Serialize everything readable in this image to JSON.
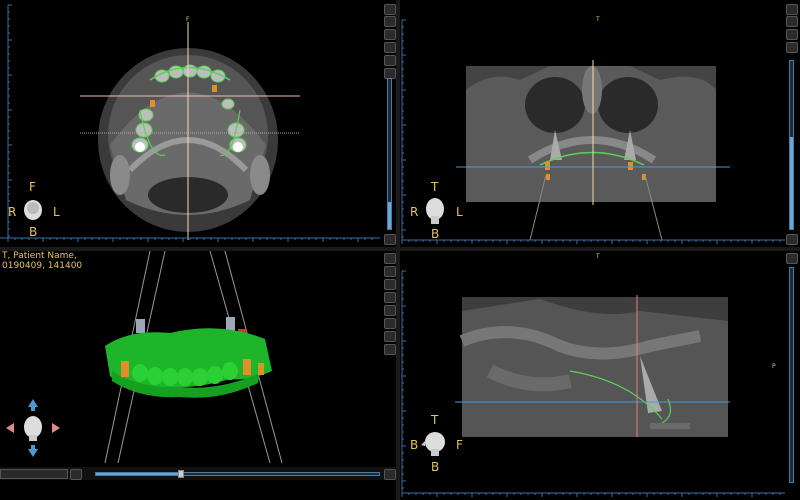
{
  "views": {
    "axial": {
      "top_marker": "F",
      "orientation": {
        "front": "F",
        "right": "R",
        "left": "L",
        "back": "B"
      },
      "crosshair_h_color": "#f0c0b0",
      "crosshair_v_color": "#f0e0a0"
    },
    "coronal": {
      "top_marker": "T",
      "orientation": {
        "top": "T",
        "right": "R",
        "left": "L",
        "bottom": "B"
      },
      "crosshair_h_color": "#4a9ad8",
      "crosshair_v_color": "#f0e0a0"
    },
    "model3d": {
      "patient_line1": "T, Patient Name,",
      "patient_line2": "0190409, 141400"
    },
    "sagittal": {
      "top_marker": "T",
      "side_marker": "P",
      "orientation": {
        "top": "T",
        "back": "B",
        "front": "F",
        "bottom": "B"
      },
      "crosshair_h_color": "#4a9ad8",
      "crosshair_v_color": "#e08080"
    }
  },
  "colors": {
    "ruler": "#3b6fa8",
    "nerve": "#5ad05a",
    "implant": "#e0902a",
    "model": "#22c42a",
    "slider": "#6aa6d6"
  },
  "icons": [
    "head-orientation-icon",
    "arrow-up-icon",
    "arrow-down-icon",
    "arrow-left-icon",
    "arrow-right-icon",
    "chevron-up-icon",
    "chevron-down-icon"
  ],
  "slider_levels": {
    "axial": 0.18,
    "coronal": 0.55,
    "bottom": 0.3
  }
}
